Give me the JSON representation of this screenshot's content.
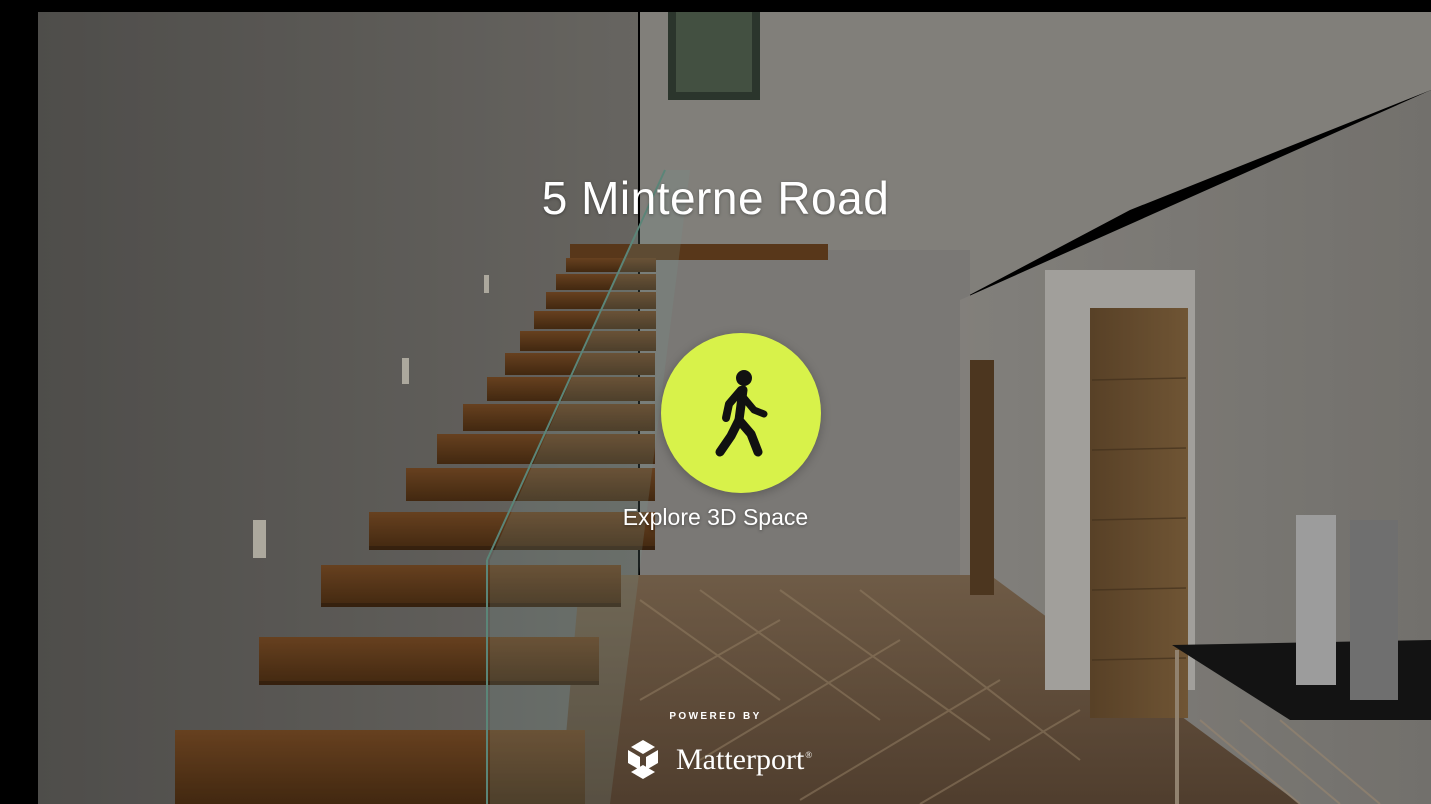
{
  "tour": {
    "title": "5 Minterne Road"
  },
  "play_button": {
    "icon": "walking-person-icon",
    "label": "Explore 3D Space"
  },
  "branding": {
    "powered_by": "POWERED BY",
    "name": "Matterport",
    "trademark": "®",
    "logo_icon": "matterport-logo-icon"
  },
  "colors": {
    "accent": "#d8f24a",
    "text": "#ffffff"
  }
}
